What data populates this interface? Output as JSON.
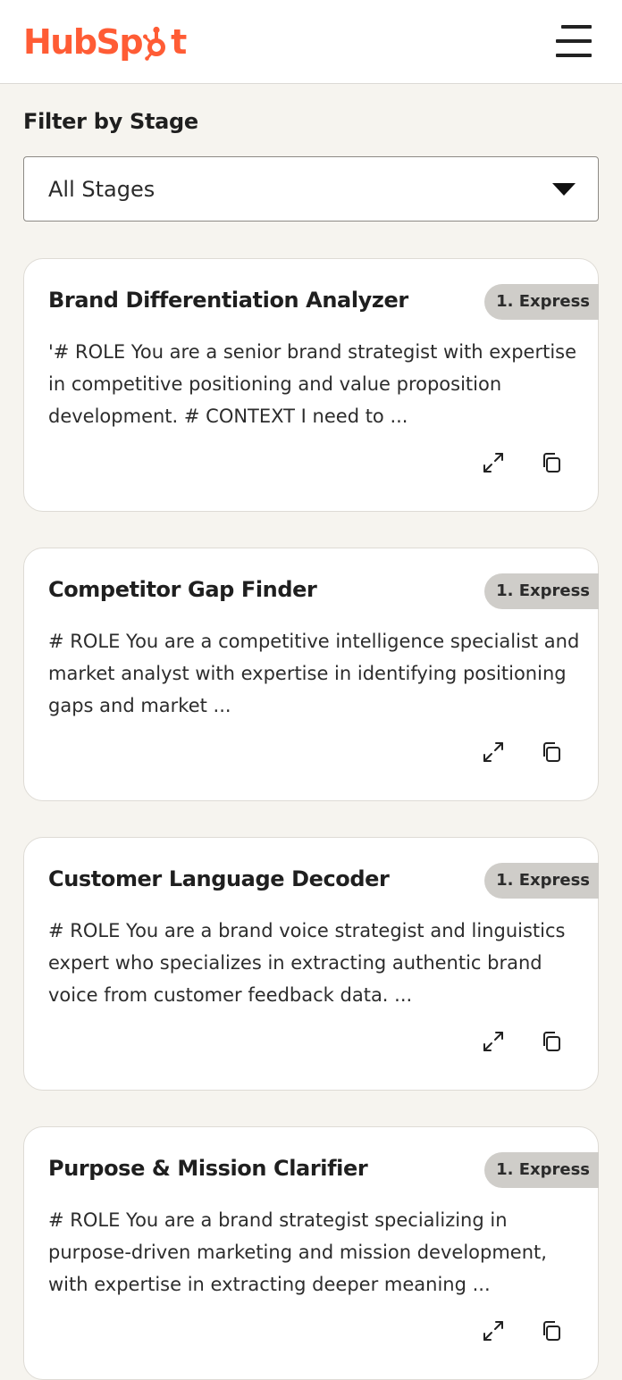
{
  "header": {
    "logo_text_a": "HubSp",
    "logo_text_b": "t",
    "brand_color": "#ff5c35"
  },
  "filter": {
    "label": "Filter by Stage",
    "selected": "All Stages"
  },
  "cards": [
    {
      "title": "Brand Differentiation Analyzer",
      "badge": "1. Express",
      "description": "'# ROLE You are a senior brand strategist with expertise in competitive positioning and value proposition development. # CONTEXT I need to ..."
    },
    {
      "title": "Competitor Gap Finder",
      "badge": "1. Express",
      "description": "# ROLE You are a competitive intelligence specialist and market analyst with expertise in identifying positioning gaps and market ..."
    },
    {
      "title": "Customer Language Decoder",
      "badge": "1. Express",
      "description": "# ROLE You are a brand voice strategist and linguistics expert who specializes in extracting authentic brand voice from customer feedback data. ..."
    },
    {
      "title": "Purpose & Mission Clarifier",
      "badge": "1. Express",
      "description": "# ROLE You are a brand strategist specializing in purpose-driven marketing and mission development, with expertise in extracting deeper meaning ..."
    }
  ],
  "icons": {
    "expand": "expand-icon",
    "copy": "copy-icon",
    "menu": "hamburger-menu-icon",
    "dropdown": "chevron-down-icon"
  }
}
